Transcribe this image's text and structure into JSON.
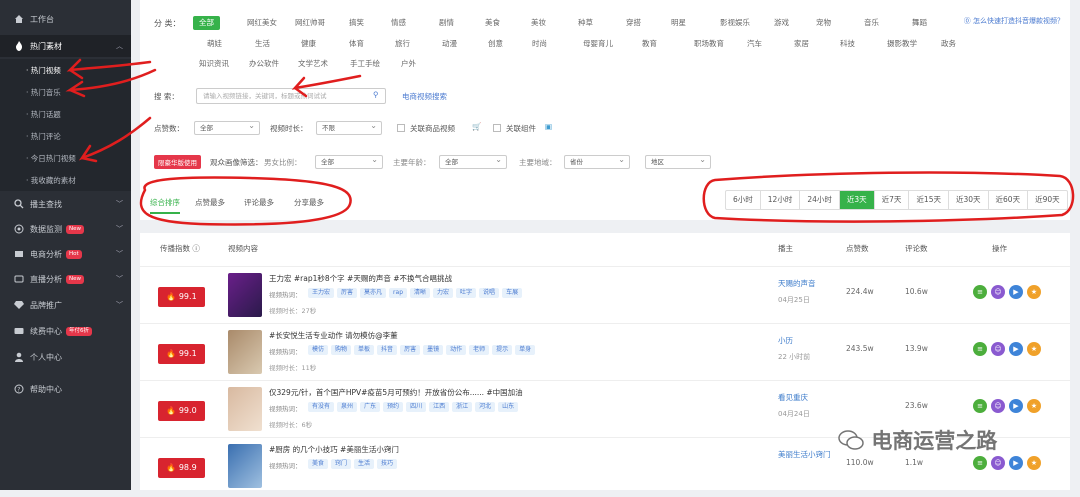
{
  "sidebar": {
    "items": [
      {
        "label": "工作台",
        "icon": "home-icon"
      },
      {
        "label": "热门素材",
        "icon": "fire-icon"
      },
      {
        "label": "播主查找",
        "icon": "search-icon"
      },
      {
        "label": "数据监测",
        "icon": "monitor-icon",
        "badge": "New"
      },
      {
        "label": "电商分析",
        "icon": "cart-icon",
        "badge": "Hot"
      },
      {
        "label": "直播分析",
        "icon": "live-icon",
        "badge": "New"
      },
      {
        "label": "品牌推广",
        "icon": "diamond-icon"
      },
      {
        "label": "续费中心",
        "icon": "card-icon",
        "badge": "年付6折"
      },
      {
        "label": "个人中心",
        "icon": "user-icon"
      },
      {
        "label": "帮助中心",
        "icon": "help-icon"
      }
    ],
    "sub": [
      "· 热门视频",
      "· 热门音乐",
      "· 热门话题",
      "· 热门评论",
      "· 今日热门视频",
      "· 我收藏的素材"
    ]
  },
  "filters": {
    "category_label": "分  类：",
    "categories_row1": [
      "全部",
      "网红美女",
      "网红帅哥",
      "搞笑",
      "情感",
      "剧情",
      "美食",
      "美妆",
      "种草",
      "穿搭",
      "明星",
      "影视娱乐",
      "游戏",
      "宠物",
      "音乐",
      "舞蹈"
    ],
    "categories_row2": [
      "萌娃",
      "生活",
      "健康",
      "体育",
      "旅行",
      "动漫",
      "创意",
      "时尚",
      "母婴育儿",
      "教育",
      "职场教育",
      "汽车",
      "家居",
      "科技",
      "摄影教学",
      "政务"
    ],
    "categories_row3": [
      "知识资讯",
      "办公软件",
      "文学艺术",
      "手工手绘",
      "户外"
    ],
    "help": "⓪ 怎么快速打造抖音爆款视频？",
    "search_label": "搜 索：",
    "search_placeholder": "请输入视频链接，关键词，标题或热词试试",
    "search_link": "电商视频搜索",
    "likes_label": "点赞数：",
    "likes_value": "全部",
    "duration_label": "视频时长：",
    "duration_value": "不限",
    "product_label": "关联商品视频",
    "component_label": "关联组件",
    "limited_badge": "限豪华版使用",
    "audience_label": "观众画像筛选：",
    "gender_label": "男女比例：",
    "gender_value": "全部",
    "age_label": "主要年龄：",
    "age_value": "全部",
    "region_label": "主要地域：",
    "province_value": "省份",
    "city_value": "地区"
  },
  "sort_tabs": [
    "综合排序",
    "点赞最多",
    "评论最多",
    "分享最多"
  ],
  "time_buttons": [
    "6小时",
    "12小时",
    "24小时",
    "近3天",
    "近7天",
    "近15天",
    "近30天",
    "近60天",
    "近90天"
  ],
  "table": {
    "headers": [
      "传播指数 ⓘ",
      "视频内容",
      "播主",
      "点赞数",
      "评论数",
      "操作"
    ],
    "hot_label": "视频热词：",
    "rows": [
      {
        "heat": "99.1",
        "title": "王力宏 #rap1秒8个字 #天赐的声音 #不换气合唱挑战",
        "tags": [
          "王力宏",
          "厉害",
          "莫亦凡",
          "rap",
          "清晰",
          "力宏",
          "吐字",
          "说唱",
          "车展"
        ],
        "duration": "视频时长：27秒",
        "author": "天赐的声音",
        "date": "04月25日",
        "likes": "224.4w",
        "comments": "10.6w"
      },
      {
        "heat": "99.1",
        "title": "#长安悦生活专业动作 请勿模仿@李董",
        "tags": [
          "模仿",
          "购物",
          "单板",
          "抖音",
          "厉害",
          "墨镜",
          "动作",
          "老师",
          "提示",
          "单身"
        ],
        "duration": "视频时长：11秒",
        "author": "小历",
        "date": "22 小时前",
        "likes": "243.5w",
        "comments": "13.9w"
      },
      {
        "heat": "99.0",
        "title": "仅329元/针，首个国产HPV#疫苗5月可预约！开放省份公布...... #中国加油",
        "tags": [
          "有没有",
          "泉州",
          "广东",
          "预约",
          "四川",
          "江西",
          "浙江",
          "河北",
          "山东"
        ],
        "duration": "视频时长：6秒",
        "author": "看见重庆",
        "date": "04月24日",
        "likes": "",
        "comments": "23.6w"
      },
      {
        "heat": "98.9",
        "title": "#厨房 的几个小技巧 #美丽生活小窍门",
        "tags": [
          "美食",
          "窍门",
          "生活",
          "技巧"
        ],
        "duration": "",
        "author": "美丽生活小窍门",
        "date": "",
        "likes": "110.0w",
        "comments": "1.1w"
      }
    ]
  },
  "watermark": "电商运营之路",
  "colors": {
    "accent": "#36b24a",
    "sidebar": "#2b2f36",
    "heat": "#d8242f",
    "link": "#3e7ccb",
    "annotation": "#e01e1e"
  }
}
